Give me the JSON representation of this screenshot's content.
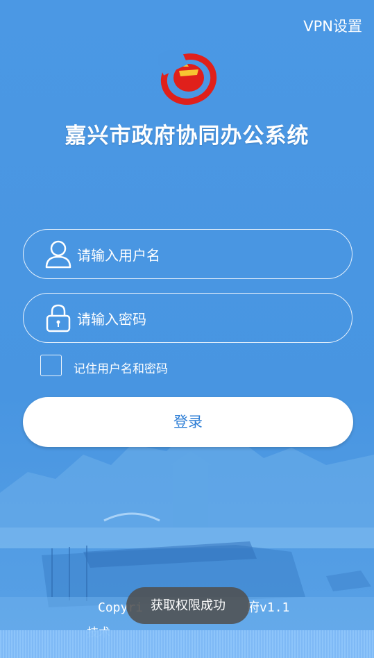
{
  "header": {
    "vpn_settings": "VPN设置"
  },
  "app": {
    "title": "嘉兴市政府协同办公系统"
  },
  "login": {
    "username_placeholder": "请输入用户名",
    "password_placeholder": "请输入密码",
    "remember_label": "记住用户名和密码",
    "remember_checked": false,
    "submit_label": "登录"
  },
  "footer": {
    "copyright_text": "Copyri",
    "copyright_tail": "府v1.1",
    "tech_text": "技术"
  },
  "toast": {
    "message": "获取权限成功"
  },
  "icons": [
    "user-icon",
    "lock-icon",
    "checkbox-icon",
    "app-logo"
  ],
  "colors": {
    "background": "#4895e1",
    "button_text": "#2f7fd6",
    "logo_red": "#e0201b"
  }
}
